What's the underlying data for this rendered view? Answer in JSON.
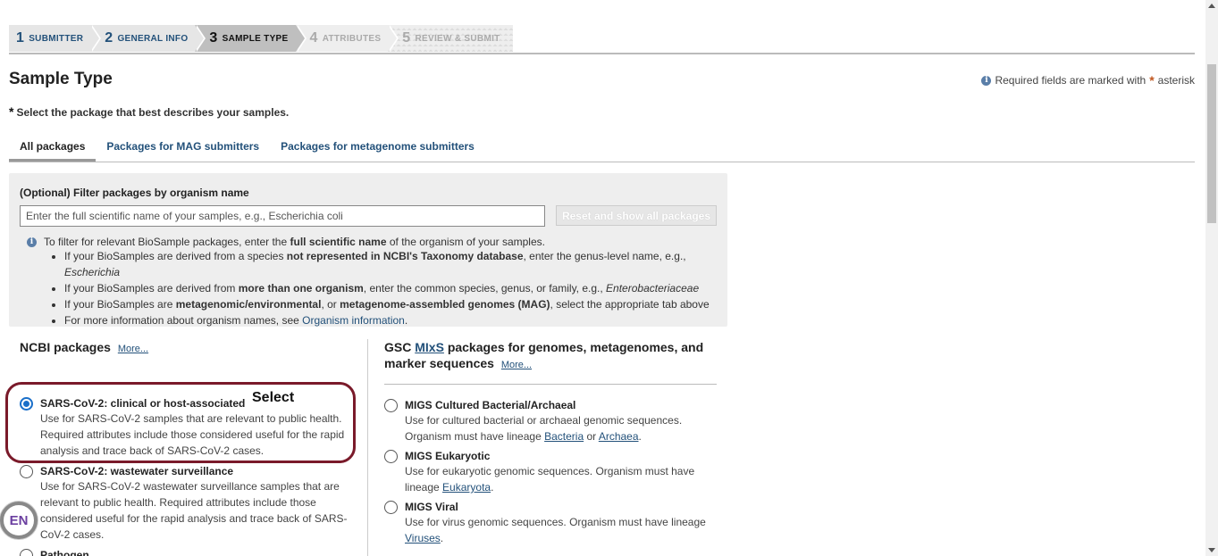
{
  "steps": [
    {
      "num": "1",
      "label": "SUBMITTER"
    },
    {
      "num": "2",
      "label": "GENERAL INFO"
    },
    {
      "num": "3",
      "label": "SAMPLE TYPE"
    },
    {
      "num": "4",
      "label": "ATTRIBUTES"
    },
    {
      "num": "5",
      "label": "REVIEW & SUBMIT"
    }
  ],
  "page": {
    "title": "Sample Type",
    "required_note": "Required fields are marked with",
    "required_word": "asterisk",
    "select_instruction": "Select the package that best describes your samples."
  },
  "tabs": [
    "All packages",
    "Packages for MAG submitters",
    "Packages for metagenome submitters"
  ],
  "filter": {
    "label": "(Optional) Filter packages by organism name",
    "placeholder": "Enter the full scientific name of your samples, e.g., Escherichia coli",
    "reset_label": "Reset and show all packages",
    "hint_pre": "To filter for relevant BioSample packages, enter the",
    "hint_bold": "full scientific name",
    "hint_post": "of the organism of your samples.",
    "b1_pre": "If your BioSamples are derived from a species",
    "b1_bold": "not represented in NCBI's Taxonomy database",
    "b1_post": ", enter the genus-level name, e.g.,",
    "b1_ital": "Escherichia",
    "b2_pre": "If your BioSamples are derived from",
    "b2_bold": "more than one organism",
    "b2_post": ", enter the common species, genus, or family, e.g.,",
    "b2_ital": "Enterobacteriaceae",
    "b3_pre": "If your BioSamples are",
    "b3_bold1": "metagenomic/environmental",
    "b3_mid": ", or",
    "b3_bold2": "metagenome-assembled genomes (MAG)",
    "b3_post": ", select the appropriate tab above",
    "b4_pre": "For more information about organism names, see",
    "b4_link": "Organism information",
    "b4_post": "."
  },
  "ncbi": {
    "heading": "NCBI packages",
    "more": "More...",
    "packages": [
      {
        "title": "SARS-CoV-2: clinical or host-associated",
        "desc": "Use for SARS-CoV-2 samples that are relevant to public health. Required attributes include those considered useful for the rapid analysis and trace back of SARS-CoV-2 cases."
      },
      {
        "title": "SARS-CoV-2: wastewater surveillance",
        "desc": "Use for SARS-CoV-2 wastewater surveillance samples that are relevant to public health. Required attributes include those considered useful for the rapid analysis and trace back of SARS-CoV-2 cases."
      },
      {
        "title": "Pathogen",
        "desc": ""
      }
    ]
  },
  "gsc": {
    "heading_pre": "GSC",
    "heading_link": "MIxS",
    "heading_post": "packages for genomes, metagenomes, and marker sequences",
    "more": "More...",
    "p1_title": "MIGS Cultured Bacterial/Archaeal",
    "p1_desc": "Use for cultured bacterial or archaeal genomic sequences. Organism must have lineage",
    "p1_link1": "Bacteria",
    "p1_or": "or",
    "p1_link2": "Archaea",
    "p2_title": "MIGS Eukaryotic",
    "p2_desc": "Use for eukaryotic genomic sequences. Organism must have lineage",
    "p2_link": "Eukaryota",
    "p3_title": "MIGS Viral",
    "p3_desc": "Use for virus genomic sequences. Organism must have lineage",
    "p3_link": "Viruses",
    "period": "."
  },
  "annotation": {
    "select_word": "Select"
  },
  "lang_badge": "EN"
}
